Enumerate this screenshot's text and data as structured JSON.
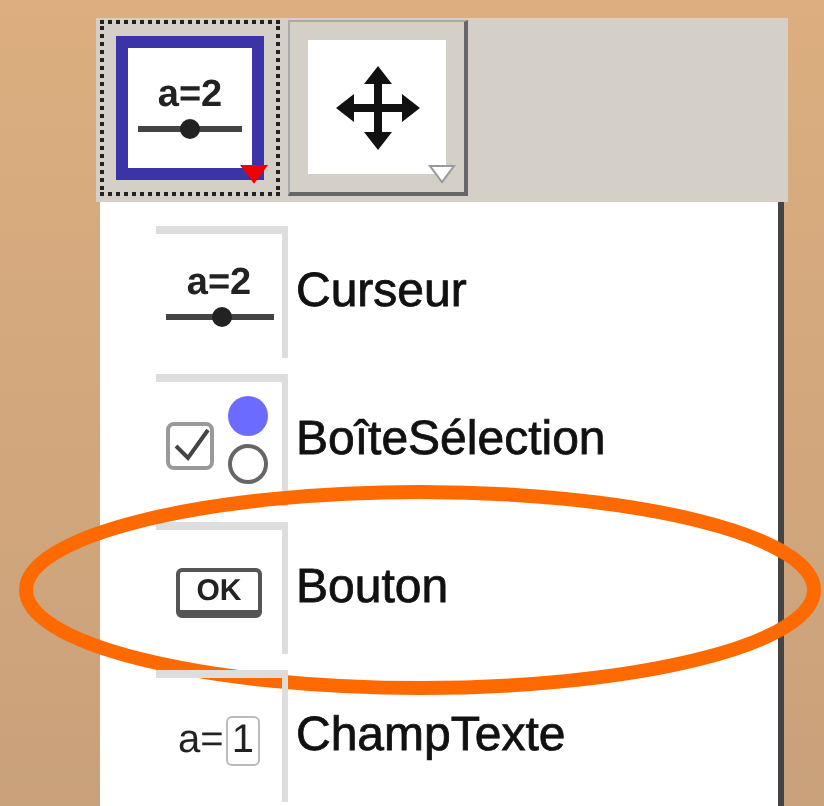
{
  "toolbar": {
    "tools": [
      {
        "kind": "slider",
        "icon_text": "a=2",
        "selected": true
      },
      {
        "kind": "move",
        "selected": false
      }
    ]
  },
  "menu": {
    "items": [
      {
        "kind": "slider",
        "icon_text": "a=2",
        "label": "Curseur",
        "circled": false
      },
      {
        "kind": "checkbox",
        "label": "BoîteSélection",
        "circled": false
      },
      {
        "kind": "button",
        "icon_text": "OK",
        "label": "Bouton",
        "circled": true
      },
      {
        "kind": "textfield",
        "icon_text": "a=",
        "field_text": "1",
        "label": "ChampTexte",
        "circled": false
      }
    ]
  }
}
